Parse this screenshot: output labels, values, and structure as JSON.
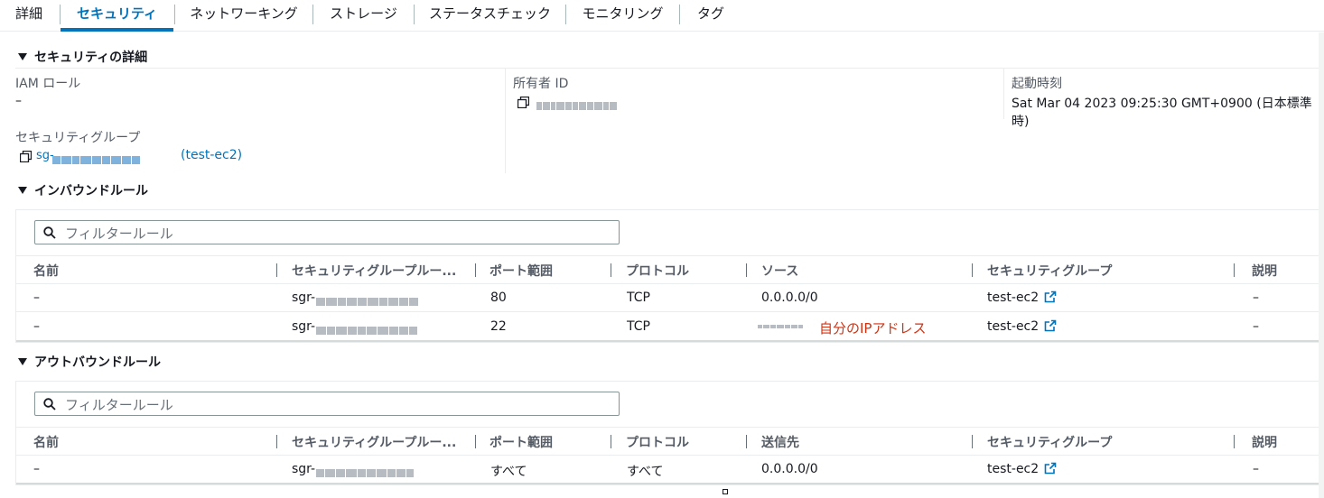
{
  "tabs": [
    {
      "label": "詳細"
    },
    {
      "label": "セキュリティ"
    },
    {
      "label": "ネットワーキング"
    },
    {
      "label": "ストレージ"
    },
    {
      "label": "ステータスチェック"
    },
    {
      "label": "モニタリング"
    },
    {
      "label": "タグ"
    }
  ],
  "active_tab": "セキュリティ",
  "security_details": {
    "title": "セキュリティの詳細",
    "iam_role_label": "IAM ロール",
    "iam_role_value": "–",
    "owner_id_label": "所有者 ID",
    "launch_time_label": "起動時刻",
    "launch_time_value": "Sat Mar 04 2023 09:25:30 GMT+0900 (日本標準時)",
    "security_groups_label": "セキュリティグループ",
    "security_group_prefix": "sg-",
    "security_group_name": "(test-ec2)"
  },
  "inbound": {
    "title": "インバウンドルール",
    "filter_placeholder": "フィルタールール",
    "columns": [
      "名前",
      "セキュリティグループルー...",
      "ポート範囲",
      "プロトコル",
      "ソース",
      "セキュリティグループ",
      "説明"
    ],
    "rows": [
      {
        "name": "–",
        "rule_prefix": "sgr-",
        "port": "80",
        "protocol": "TCP",
        "source": "0.0.0.0/0",
        "sg": "test-ec2",
        "desc": "–"
      },
      {
        "name": "–",
        "rule_prefix": "sgr-",
        "port": "22",
        "protocol": "TCP",
        "source": "",
        "sg": "test-ec2",
        "desc": "–"
      }
    ],
    "annotation": "自分のIPアドレス"
  },
  "outbound": {
    "title": "アウトバウンドルール",
    "filter_placeholder": "フィルタールール",
    "columns": [
      "名前",
      "セキュリティグループルー...",
      "ポート範囲",
      "プロトコル",
      "送信先",
      "セキュリティグループ",
      "説明"
    ],
    "rows": [
      {
        "name": "–",
        "rule_prefix": "sgr-",
        "port": "すべて",
        "protocol": "すべて",
        "dest": "0.0.0.0/0",
        "sg": "test-ec2",
        "desc": "–"
      }
    ]
  },
  "colors": {
    "accent": "#0073bb",
    "text": "#16191f",
    "annotation": "#d13212"
  },
  "icons": [
    "copy-icon",
    "search-icon",
    "external-link-icon",
    "caret-down-icon"
  ]
}
